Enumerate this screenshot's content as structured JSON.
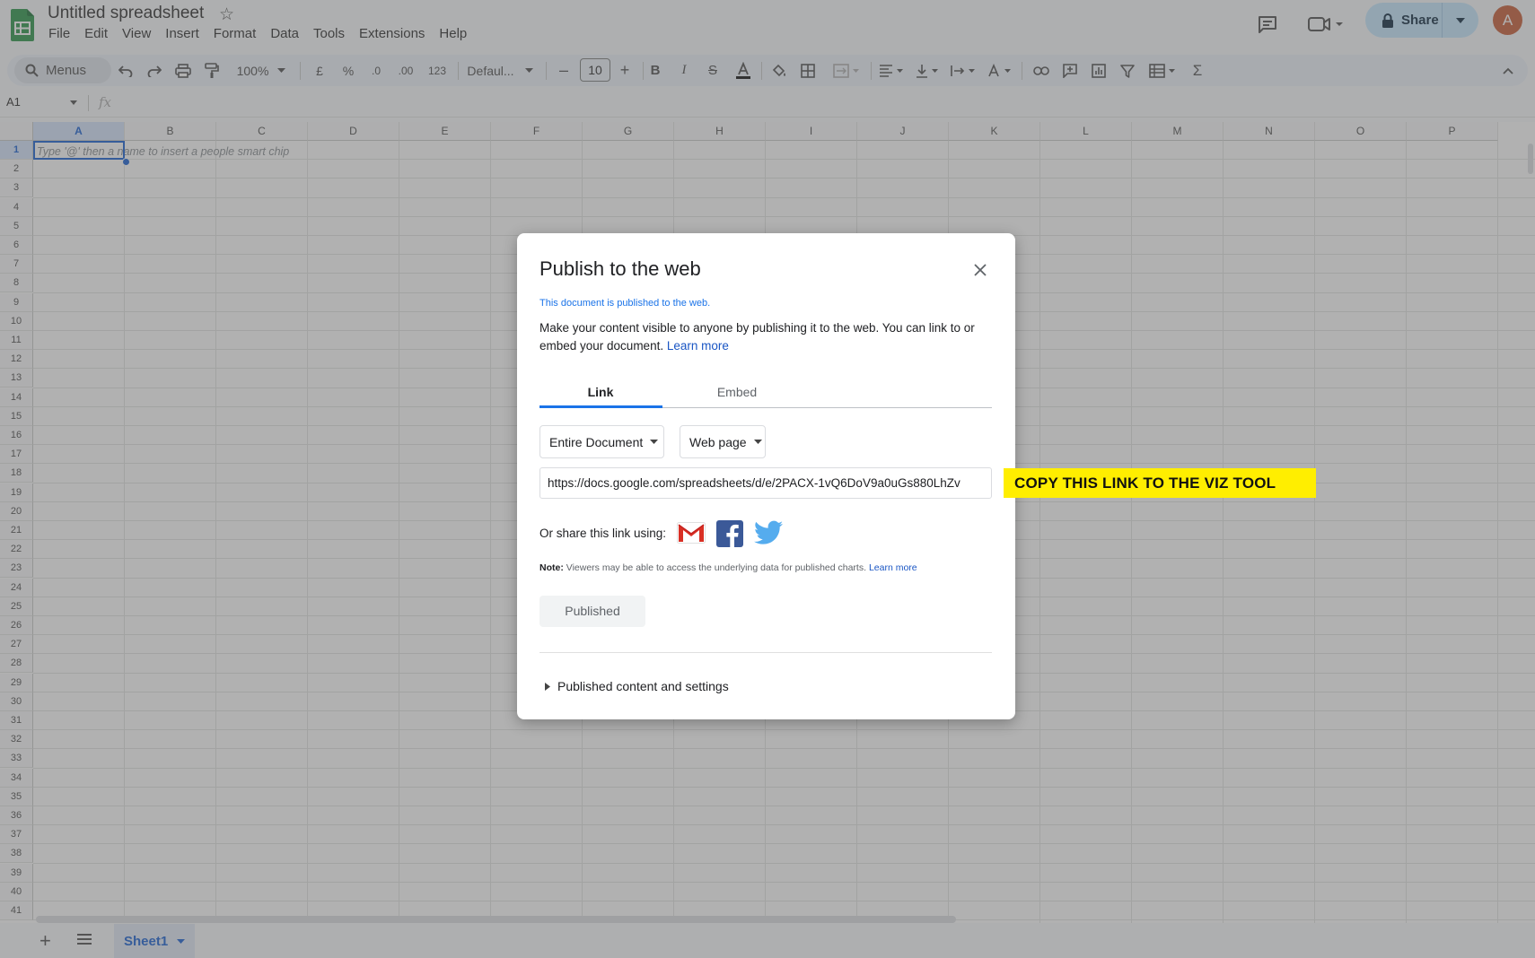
{
  "app": {
    "title": "Untitled spreadsheet",
    "menu": [
      "File",
      "Edit",
      "View",
      "Insert",
      "Format",
      "Data",
      "Tools",
      "Extensions",
      "Help"
    ],
    "share_label": "Share",
    "avatar_initial": "A",
    "brand_color": "#1e8e3e"
  },
  "toolbar": {
    "menus_label": "Menus",
    "zoom": "100%",
    "currency": "£",
    "percent": "%",
    "decrease_decimal": ".0",
    "increase_decimal": ".00",
    "number_format": "123",
    "font": "Defaul...",
    "font_size": "10"
  },
  "formula_bar": {
    "name_box": "A1",
    "fx": "fx"
  },
  "sheet": {
    "columns": [
      "A",
      "B",
      "C",
      "D",
      "E",
      "F",
      "G",
      "H",
      "I",
      "J",
      "K",
      "L",
      "M",
      "N",
      "O",
      "P"
    ],
    "rows": [
      "1",
      "2",
      "3",
      "4",
      "5",
      "6",
      "7",
      "8",
      "9",
      "10",
      "11",
      "12",
      "13",
      "14",
      "15",
      "16",
      "17",
      "18",
      "19",
      "20",
      "21",
      "22",
      "23",
      "24",
      "25",
      "26",
      "27",
      "28",
      "29",
      "30",
      "31",
      "32",
      "33",
      "34",
      "35",
      "36",
      "37",
      "38",
      "39",
      "40",
      "41"
    ],
    "selected_cell": "A1",
    "cell_hint": "Type '@' then a name to insert a people smart chip"
  },
  "bottom_bar": {
    "add_sheet": "+",
    "sheet_tab": "Sheet1"
  },
  "dialog": {
    "title": "Publish to the web",
    "status": "This document is published to the web.",
    "description": "Make your content visible to anyone by publishing it to the web. You can link to or embed your document.",
    "learn_more": "Learn more",
    "tabs": {
      "link": "Link",
      "embed": "Embed"
    },
    "scope_select": "Entire Document",
    "format_select": "Web page",
    "url": "https://docs.google.com/spreadsheets/d/e/2PACX-1vQ6DoV9a0uGs880LhZv",
    "share_label": "Or share this link using:",
    "note_label": "Note:",
    "note_text": "Viewers may be able to access the underlying data for published charts.",
    "note_learn_more": "Learn more",
    "published_button": "Published",
    "settings_disclosure": "Published content and settings"
  },
  "callout": {
    "text": "COPY THIS LINK TO THE VIZ TOOL",
    "color": "#ffee00"
  }
}
